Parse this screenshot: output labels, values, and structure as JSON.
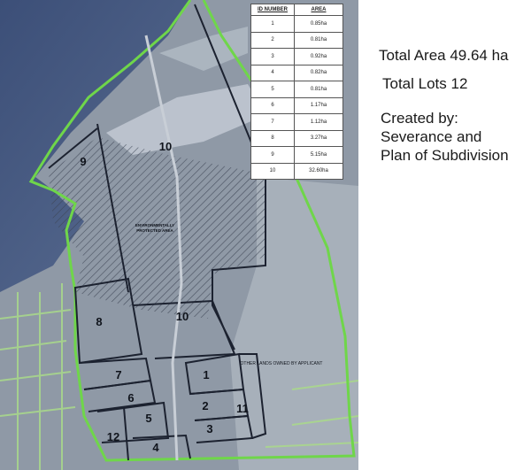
{
  "table": {
    "header_number": "ID NUMBER",
    "header_area": "AREA",
    "rows": [
      {
        "number": "1",
        "area": "0.85ha"
      },
      {
        "number": "2",
        "area": "0.81ha"
      },
      {
        "number": "3",
        "area": "0.92ha"
      },
      {
        "number": "4",
        "area": "0.82ha"
      },
      {
        "number": "5",
        "area": "0.81ha"
      },
      {
        "number": "6",
        "area": "1.17ha"
      },
      {
        "number": "7",
        "area": "1.12ha"
      },
      {
        "number": "8",
        "area": "3.27ha"
      },
      {
        "number": "9",
        "area": "5.15ha"
      },
      {
        "number": "10",
        "area": "32.60ha"
      }
    ]
  },
  "info": {
    "total_area": "Total Area 49.64 ha",
    "total_lots": "Total Lots 12",
    "created_by_lines": [
      "Created by:",
      "Severance and",
      "Plan of Subdivision"
    ]
  },
  "map": {
    "lot_labels": {
      "lot9": "9",
      "lot10_north": "10",
      "lot10_south": "10",
      "lot8": "8",
      "lot7": "7",
      "lot6": "6",
      "lot5": "5",
      "lot4": "4",
      "lot12": "12",
      "lot1": "1",
      "lot2": "2",
      "lot3": "3",
      "lot11": "11"
    },
    "protected_area_line1": "ENVIRONMENTALLY",
    "protected_area_line2": "PROTECTED AREA",
    "other_lands_label": "OTHER LANDS OWNED BY APPLICANT",
    "colors": {
      "water": "#4a5d80",
      "land": "#9ea8b3",
      "boundary_green": "#6fd64a",
      "lot_line": "#1c2230",
      "road": "#c8ced6"
    }
  }
}
